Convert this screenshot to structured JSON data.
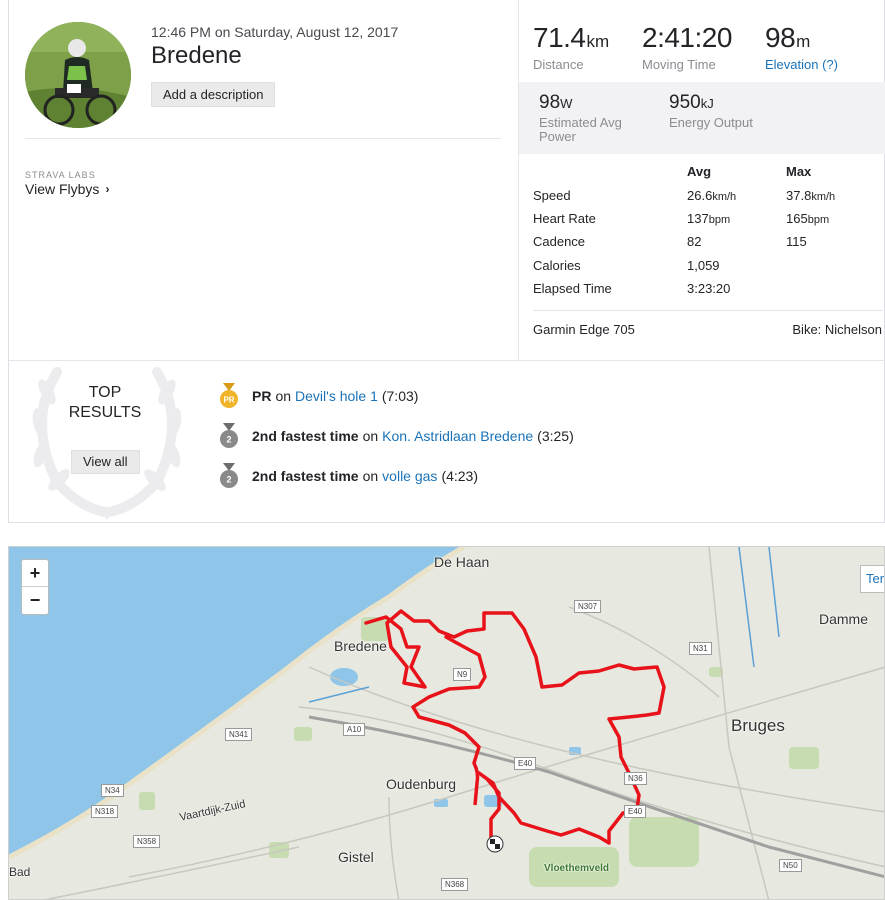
{
  "activity": {
    "timestamp": "12:46 PM on Saturday, August 12, 2017",
    "title": "Bredene",
    "add_description_label": "Add a description",
    "labs_label": "STRAVA LABS",
    "flybys_label": "View Flybys"
  },
  "stats": {
    "distance": {
      "value": "71.4",
      "unit": "km",
      "label": "Distance"
    },
    "moving_time": {
      "value": "2:41:20",
      "label": "Moving Time"
    },
    "elevation": {
      "value": "98",
      "unit": "m",
      "label": "Elevation (?)"
    },
    "power": {
      "value": "98",
      "unit": "W",
      "label": "Estimated Avg Power"
    },
    "energy": {
      "value": "950",
      "unit": "kJ",
      "label": "Energy Output"
    },
    "table": {
      "headers": [
        "",
        "Avg",
        "Max"
      ],
      "rows": [
        {
          "label": "Speed",
          "avg": "26.6",
          "avg_unit": "km/h",
          "max": "37.8",
          "max_unit": "km/h"
        },
        {
          "label": "Heart Rate",
          "avg": "137",
          "avg_unit": "bpm",
          "max": "165",
          "max_unit": "bpm"
        },
        {
          "label": "Cadence",
          "avg": "82",
          "avg_unit": "",
          "max": "115",
          "max_unit": ""
        },
        {
          "label": "Calories",
          "avg": "1,059",
          "avg_unit": "",
          "max": "",
          "max_unit": ""
        },
        {
          "label": "Elapsed Time",
          "avg": "3:23:20",
          "avg_unit": "",
          "max": "",
          "max_unit": ""
        }
      ]
    },
    "device": "Garmin Edge 705",
    "bike": "Bike: Nichelson"
  },
  "top_results": {
    "title_line1": "TOP",
    "title_line2": "RESULTS",
    "view_all_label": "View all",
    "items": [
      {
        "medal": "PR",
        "medal_color": "#f0b429",
        "achievement": "PR",
        "on": "on",
        "segment": "Devil's hole 1",
        "time": "(7:03)"
      },
      {
        "medal": "2",
        "medal_color": "#8a8a8a",
        "achievement": "2nd fastest time",
        "on": "on",
        "segment": "Kon. Astridlaan Bredene",
        "time": "(3:25)"
      },
      {
        "medal": "2",
        "medal_color": "#8a8a8a",
        "achievement": "2nd fastest time",
        "on": "on",
        "segment": "volle gas",
        "time": "(4:23)"
      }
    ]
  },
  "map": {
    "zoom_in": "+",
    "zoom_out": "−",
    "terrain_label": "Terr",
    "places": [
      "De Haan",
      "Bredene",
      "Damme",
      "Bruges",
      "Oudenburg",
      "Gistel",
      "Vloethemveld",
      "Vaartdijk-Zuid",
      "Bad"
    ],
    "roads": [
      "N307",
      "N9",
      "N31",
      "A10",
      "N341",
      "E40",
      "N36",
      "N34",
      "N318",
      "N358",
      "E40",
      "N368",
      "N50"
    ],
    "colors": {
      "sea": "#8fc5e8",
      "land": "#e7e8df",
      "route": "#e8131a"
    }
  }
}
